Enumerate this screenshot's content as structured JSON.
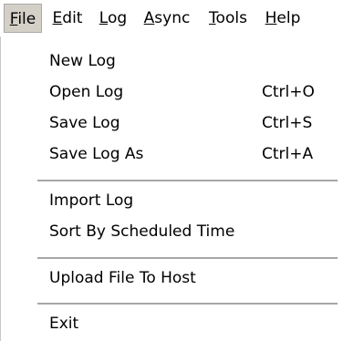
{
  "menubar": {
    "items": [
      {
        "pre": "",
        "key": "F",
        "post": "ile"
      },
      {
        "pre": "",
        "key": "E",
        "post": "dit"
      },
      {
        "pre": "",
        "key": "L",
        "post": "og"
      },
      {
        "pre": "",
        "key": "A",
        "post": "sync"
      },
      {
        "pre": "",
        "key": "T",
        "post": "ools"
      },
      {
        "pre": "",
        "key": "H",
        "post": "elp"
      }
    ]
  },
  "file_menu": {
    "items": [
      {
        "label": "New Log",
        "shortcut": ""
      },
      {
        "label": "Open Log",
        "shortcut": "Ctrl+O"
      },
      {
        "label": "Save Log",
        "shortcut": "Ctrl+S"
      },
      {
        "label": "Save Log As",
        "shortcut": "Ctrl+A"
      },
      {
        "label": "Import Log",
        "shortcut": ""
      },
      {
        "label": "Sort By Scheduled Time",
        "shortcut": ""
      },
      {
        "label": "Upload File To Host",
        "shortcut": ""
      },
      {
        "label": "Exit",
        "shortcut": ""
      }
    ]
  }
}
